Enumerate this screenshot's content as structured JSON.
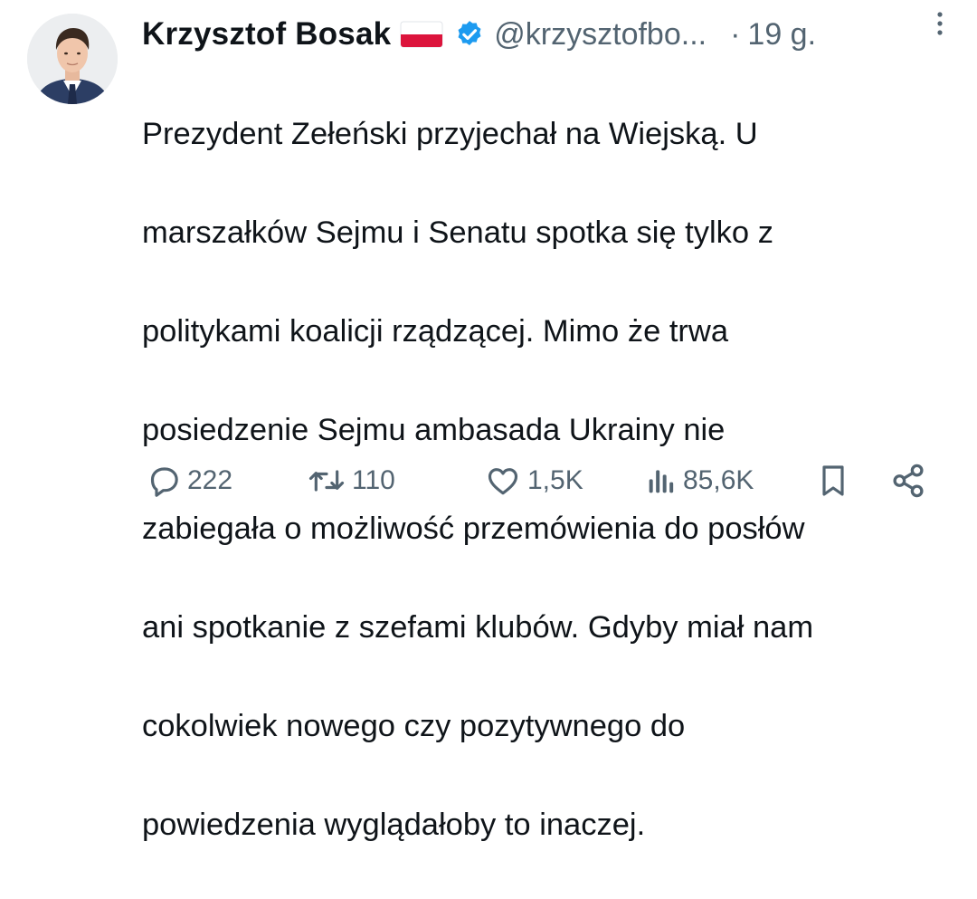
{
  "author": {
    "name": "Krzysztof Bosak",
    "handle": "@krzysztofbo...",
    "separator": "·",
    "time": "19 g."
  },
  "tweet_text": "Prezydent Zełeński przyjechał na Wiejską. U marszałków Sejmu i Senatu spotka się tylko z politykami koalicji rządzącej. Mimo że trwa posiedzenie Sejmu ambasada Ukrainy nie zabiegała o możliwość przemówienia do posłów ani spotkanie z szefami klubów. Gdyby miał nam cokolwiek nowego czy pozytywnego do powiedzenia wyglądałoby to inaczej.",
  "tweet_lines": [
    "Prezydent Zełeński przyjechał na Wiejską. U",
    "marszałków Sejmu i Senatu spotka się tylko z",
    "politykami koalicji rządzącej. Mimo że trwa",
    "posiedzenie Sejmu ambasada Ukrainy nie",
    "zabiegała o możliwość przemówienia do posłów",
    "ani spotkanie z szefami klubów. Gdyby miał nam",
    "cokolwiek nowego czy pozytywnego do",
    "powiedzenia wyglądałoby to inaczej."
  ],
  "actions": {
    "replies": "222",
    "reposts": "110",
    "likes": "1,5K",
    "views": "85,6K"
  },
  "icons": {
    "flag": "poland-flag-emoji",
    "verified": "verified-badge-icon",
    "more": "more-vertical-icon",
    "reply": "reply-icon",
    "repost": "repost-icon",
    "like": "heart-icon",
    "views": "views-icon",
    "bookmark": "bookmark-icon",
    "share": "share-icon"
  },
  "colors": {
    "text": "#0f1419",
    "secondary": "#536471",
    "verified": "#1d9bf0",
    "flag_red": "#dc143c"
  }
}
